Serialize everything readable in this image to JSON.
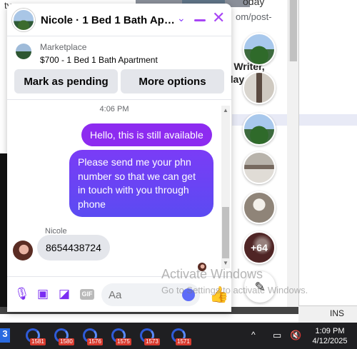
{
  "background": {
    "url_fragment": "om/post-",
    "today_text": "oday",
    "writer_text": "r Writer,",
    "day_text": "day",
    "ins_label": "INS",
    "left_fragment": "ty"
  },
  "chat": {
    "title": "Nicole · 1 Bed 1 Bath Apart...",
    "marketplace_label": "Marketplace",
    "marketplace_item": "$700 - 1 Bed 1 Bath Apartment",
    "mark_pending_label": "Mark as pending",
    "more_options_label": "More options",
    "timestamp": "4:06 PM",
    "outgoing_1": "Hello, this is still available",
    "outgoing_2": "Please send me your phn number so that we can get in touch with you through phone",
    "sender_name": "Nicole",
    "incoming_1": "8654438724",
    "input_placeholder": "Aa",
    "gif_label": "GIF"
  },
  "rail": {
    "more_count": "+64"
  },
  "watermark": {
    "title": "Activate Windows",
    "subtitle": "Go to Settings to activate Windows."
  },
  "taskbar": {
    "apps": [
      {
        "badge": "1581"
      },
      {
        "badge": "1580"
      },
      {
        "badge": "1576"
      },
      {
        "badge": "1575"
      },
      {
        "badge": "1573"
      },
      {
        "badge": "1571"
      }
    ],
    "time": "1:09 PM",
    "date": "4/12/2025"
  },
  "colors": {
    "accent": "#8d2bf0",
    "bubble_gradient_start": "#7a3cf6",
    "bubble_gradient_end": "#5b4bf2",
    "taskbar": "#1f1f22"
  }
}
